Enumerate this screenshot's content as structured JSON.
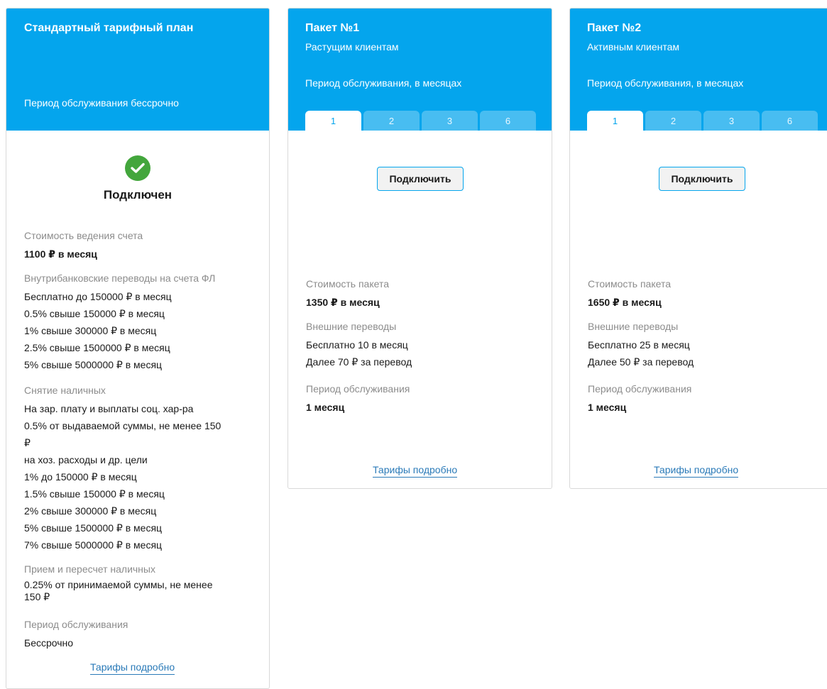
{
  "cards": [
    {
      "title": "Стандартный тарифный план",
      "period_header": "Период обслуживания бессрочно",
      "status_label": "Подключен",
      "icon": "check-circle-icon",
      "sections": {
        "account_cost": {
          "label": "Стоимость ведения счета",
          "value": "1100 ₽ в месяц"
        },
        "internal_transfers": {
          "label": "Внутрибанковские переводы на счета ФЛ",
          "lines": [
            "Бесплатно до 150000 ₽ в месяц",
            "0.5% свыше 150000 ₽ в месяц",
            "1% свыше 300000 ₽ в месяц",
            "2.5% свыше 1500000 ₽ в месяц",
            "5% свыше 5000000 ₽ в месяц"
          ]
        },
        "cash_withdrawal": {
          "label": "Снятие наличных",
          "lines": [
            "На зар. плату и выплаты соц. хар-ра",
            "0.5% от выдаваемой суммы, не менее 150",
            "₽",
            "на хоз. расходы и др. цели",
            "1% до 150000 ₽ в месяц",
            "1.5% свыше 150000 ₽ в месяц",
            "2% свыше 300000 ₽ в месяц",
            "5% свыше 1500000 ₽ в месяц",
            "7% свыше 5000000 ₽ в месяц"
          ]
        },
        "cash_deposit": {
          "label": "Прием и пересчет наличных",
          "lines": [
            "0.25% от принимаемой суммы, не менее",
            "150 ₽"
          ]
        },
        "service_period": {
          "label": "Период обслуживания",
          "value": "Бессрочно"
        }
      },
      "details_link": "Тарифы подробно"
    },
    {
      "title": "Пакет №1",
      "subtitle": "Растущим клиентам",
      "period_header": "Период обслуживания, в месяцах",
      "tabs": [
        "1",
        "2",
        "3",
        "6"
      ],
      "active_tab": "1",
      "connect_button": "Подключить",
      "sections": {
        "package_cost": {
          "label": "Стоимость пакета",
          "value": "1350 ₽ в месяц"
        },
        "external_transfers": {
          "label": "Внешние переводы",
          "lines": [
            "Бесплатно 10 в месяц",
            "Далее 70 ₽ за перевод"
          ]
        },
        "service_period": {
          "label": "Период обслуживания",
          "value": "1 месяц"
        }
      },
      "details_link": "Тарифы подробно"
    },
    {
      "title": "Пакет №2",
      "subtitle": "Активным клиентам",
      "period_header": "Период обслуживания, в месяцах",
      "tabs": [
        "1",
        "2",
        "3",
        "6"
      ],
      "active_tab": "1",
      "connect_button": "Подключить",
      "sections": {
        "package_cost": {
          "label": "Стоимость пакета",
          "value": "1650 ₽ в месяц"
        },
        "external_transfers": {
          "label": "Внешние переводы",
          "lines": [
            "Бесплатно 25 в месяц",
            "Далее 50 ₽ за перевод"
          ]
        },
        "service_period": {
          "label": "Период обслуживания",
          "value": "1 месяц"
        }
      },
      "details_link": "Тарифы подробно"
    }
  ],
  "colors": {
    "header_blue": "#04a5ed",
    "tab_inactive": "#48bdf1",
    "success_green": "#43a63c",
    "link": "#2a7ab8",
    "label_gray": "#8c8c8c"
  }
}
